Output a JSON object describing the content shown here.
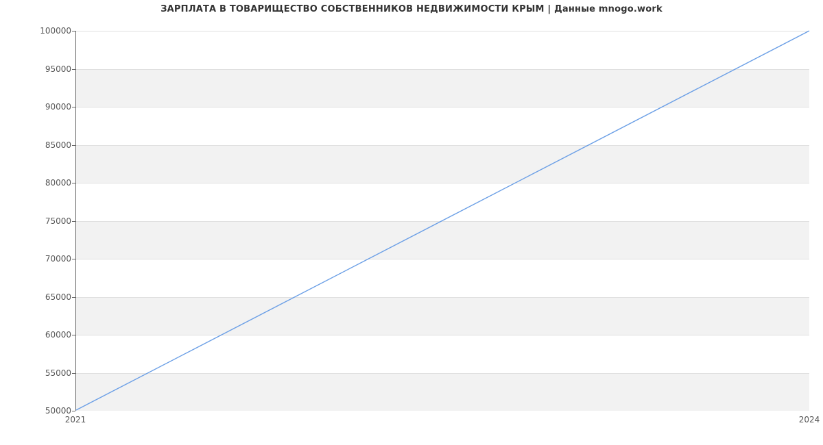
{
  "chart_data": {
    "type": "line",
    "title": "ЗАРПЛАТА В ТОВАРИЩЕСТВО СОБСТВЕННИКОВ НЕДВИЖИМОСТИ КРЫМ | Данные mnogo.work",
    "x": [
      2021,
      2024
    ],
    "values": [
      50000,
      100000
    ],
    "xlabel": "",
    "ylabel": "",
    "xlim": [
      2021,
      2024
    ],
    "ylim": [
      50000,
      100000
    ],
    "y_ticks": [
      50000,
      55000,
      60000,
      65000,
      70000,
      75000,
      80000,
      85000,
      90000,
      95000,
      100000
    ],
    "x_ticks": [
      2021,
      2024
    ],
    "line_color": "#6b9fe6",
    "grid": true,
    "banded_background": true
  }
}
